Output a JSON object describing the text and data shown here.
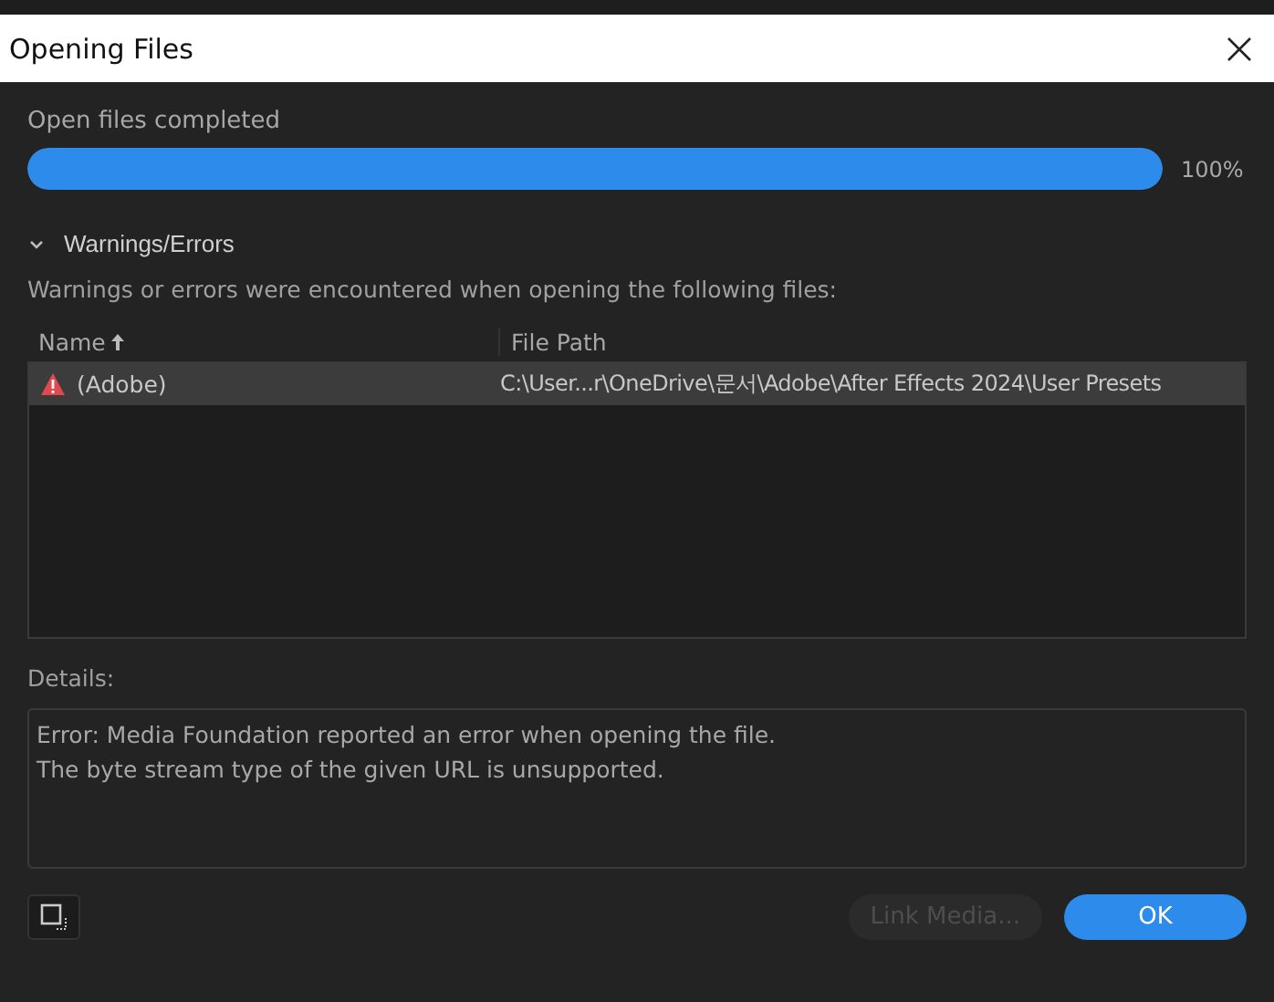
{
  "window": {
    "title": "Opening Files"
  },
  "progress": {
    "label": "Open files completed",
    "level": 1,
    "reading": "100%"
  },
  "section": {
    "title": "Warnings/Errors",
    "expanded": true,
    "description": "Warnings or errors were encountered when opening the following files:"
  },
  "table": {
    "columns": [
      {
        "label": "Name",
        "sorted": true
      },
      {
        "label": "File Path",
        "sorted": false
      }
    ],
    "rows": [
      {
        "kind": "warning",
        "name": "(Adobe)",
        "path": "C:\\User...r\\OneDrive\\문서\\Adobe\\After Effects 2024\\User Presets",
        "selected": true
      }
    ]
  },
  "details": {
    "label": "Details:",
    "lines": [
      "Error: Media Foundation reported an error when opening the file.",
      "The byte stream type of the given URL is unsupported."
    ]
  },
  "buttons": [
    {
      "label": "Link Media...",
      "disabled": true,
      "primary": false
    },
    {
      "label": "OK",
      "disabled": false,
      "primary": true
    }
  ]
}
